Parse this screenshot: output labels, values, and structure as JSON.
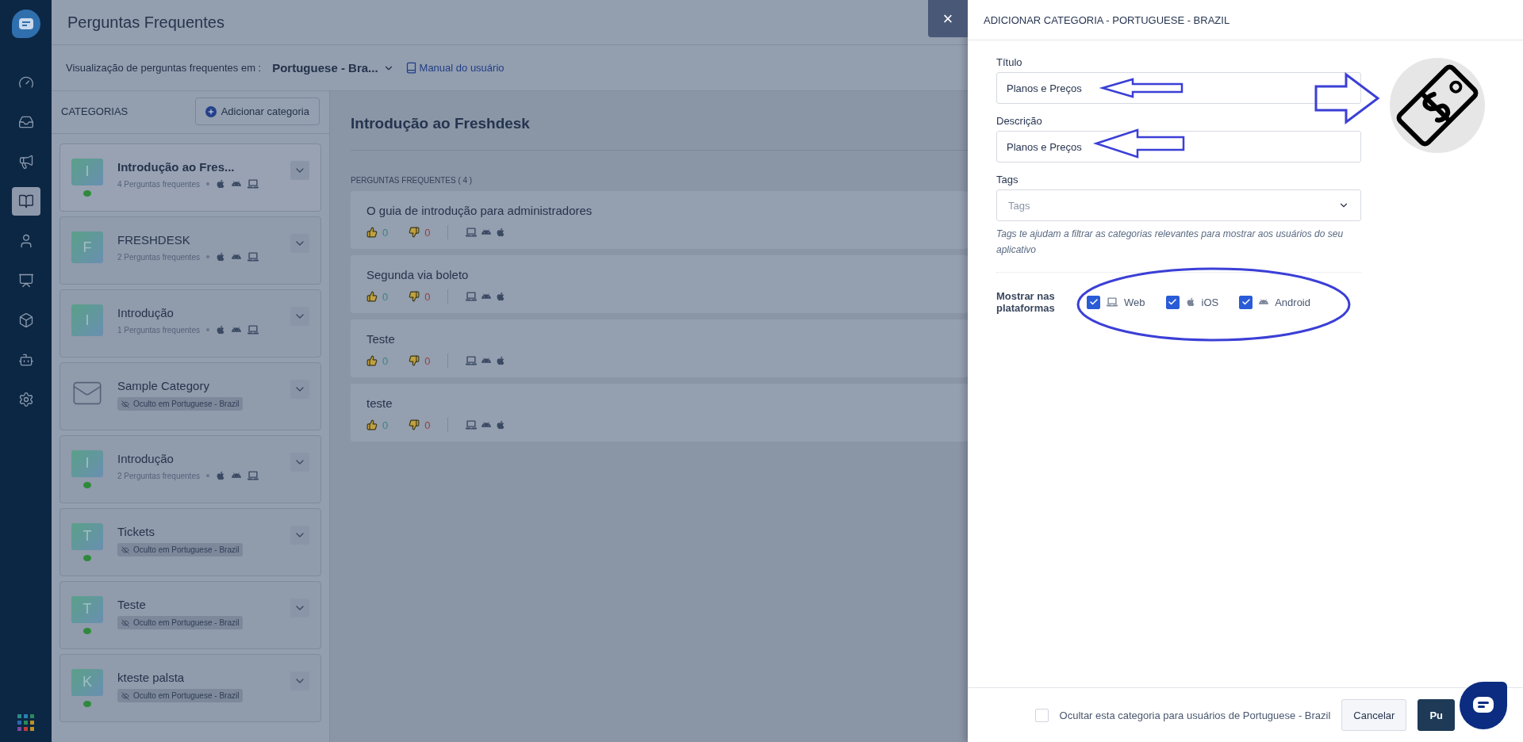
{
  "page_title": "Perguntas Frequentes",
  "view_bar": {
    "label": "Visualização de perguntas frequentes em :",
    "language": "Portuguese - Bra...",
    "manual_link": "Manual do usuário"
  },
  "categories_panel": {
    "heading": "CATEGORIAS",
    "add_button": "Adicionar categoria",
    "items": [
      {
        "kind": "letter",
        "letter": "I",
        "name": "Introdução ao Fres...",
        "faq_count": "4 Perguntas frequentes",
        "indicator": true,
        "selected": true
      },
      {
        "kind": "letter",
        "letter": "F",
        "name": "FRESHDESK",
        "faq_count": "2 Perguntas frequentes",
        "indicator": false,
        "selected": false
      },
      {
        "kind": "letter",
        "letter": "I",
        "name": "Introdução",
        "faq_count": "1 Perguntas frequentes",
        "indicator": false,
        "selected": false
      },
      {
        "kind": "envelope",
        "name": "Sample Category",
        "hidden_badge": "Oculto em Portuguese - Brazil",
        "indicator": false,
        "selected": false
      },
      {
        "kind": "letter",
        "letter": "I",
        "name": "Introdução",
        "faq_count": "2 Perguntas frequentes",
        "indicator": true,
        "selected": false
      },
      {
        "kind": "letter",
        "letter": "T",
        "name": "Tickets",
        "hidden_badge": "Oculto em Portuguese - Brazil",
        "indicator": true,
        "selected": false
      },
      {
        "kind": "letter",
        "letter": "T",
        "name": "Teste",
        "hidden_badge": "Oculto em Portuguese - Brazil",
        "indicator": true,
        "selected": false
      },
      {
        "kind": "letter",
        "letter": "K",
        "name": "kteste palsta",
        "hidden_badge": "Oculto em Portuguese - Brazil",
        "indicator": true,
        "selected": false
      }
    ]
  },
  "category_detail": {
    "title": "Introdução ao Freshdesk",
    "faq_heading": "PERGUNTAS FREQUENTES ( 4 )",
    "faqs": [
      {
        "title": "O guia de introdução para administradores",
        "likes": "0",
        "dislikes": "0"
      },
      {
        "title": "Segunda via boleto",
        "likes": "0",
        "dislikes": "0"
      },
      {
        "title": "Teste",
        "likes": "0",
        "dislikes": "0"
      },
      {
        "title": "teste",
        "likes": "0",
        "dislikes": "0"
      }
    ]
  },
  "drawer": {
    "close": "×",
    "title": "ADICIONAR CATEGORIA - PORTUGUESE - BRAZIL",
    "fields": [
      {
        "label": "Título",
        "value": "Planos e Preços"
      },
      {
        "label": "Descrição",
        "value": "Planos e Preços"
      }
    ],
    "tags": {
      "label": "Tags",
      "placeholder": "Tags",
      "help": "Tags te ajudam a filtrar as categorias relevantes para mostrar aos usuários do seu aplicativo"
    },
    "platforms": {
      "label": "Mostrar nas plataformas",
      "options": [
        {
          "kind": "web",
          "label": "Web",
          "checked": true
        },
        {
          "kind": "ios",
          "label": "iOS",
          "checked": true
        },
        {
          "kind": "android",
          "label": "Android",
          "checked": true
        }
      ]
    },
    "hide_option": {
      "label": "Ocultar esta categoria para usuários de Portuguese - Brazil",
      "checked": false
    },
    "buttons": [
      {
        "kind": "secondary",
        "label": "Cancelar"
      },
      {
        "kind": "primary",
        "label": "Pu"
      }
    ]
  }
}
